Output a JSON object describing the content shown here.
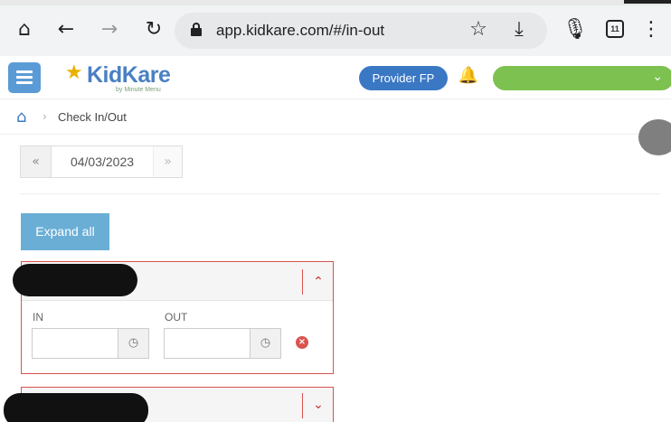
{
  "browser": {
    "url": "app.kidkare.com/#/in-out",
    "tab_count": "11",
    "icons": [
      "home-icon",
      "back-icon",
      "forward-icon",
      "reload-icon",
      "lock-icon",
      "star-icon",
      "download-icon",
      "mic-icon",
      "tabs-icon",
      "more-icon"
    ]
  },
  "header": {
    "logo_text": "KidKare",
    "logo_subtext": "by Minute Menu",
    "provider_button": "Provider FP"
  },
  "breadcrumb": {
    "current": "Check In/Out"
  },
  "date_nav": {
    "prev": "«",
    "date": "04/03/2023",
    "next": "»"
  },
  "actions": {
    "expand_all": "Expand all"
  },
  "children": [
    {
      "in_label": "IN",
      "out_label": "OUT",
      "in_value": "",
      "out_value": "",
      "expanded": true
    },
    {
      "expanded": false
    }
  ],
  "colors": {
    "accent": "#3a78c4",
    "menu": "#5b9bd5",
    "expand_button": "#6aaed6",
    "status_green": "#7dc250",
    "danger": "#d9534f"
  }
}
